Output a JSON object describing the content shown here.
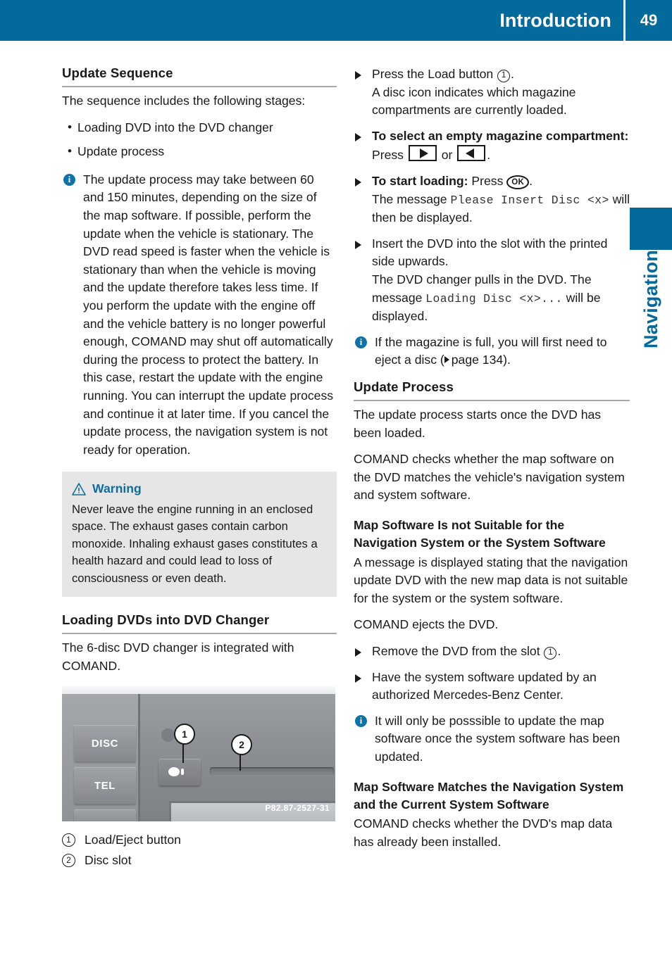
{
  "header": {
    "title": "Introduction",
    "page_number": "49"
  },
  "side_tab": {
    "label": "Navigation"
  },
  "left_column": {
    "section_heading": "Update Sequence",
    "intro": "The sequence includes the following stages:",
    "bullets": [
      "Loading DVD into the DVD changer",
      "Update process"
    ],
    "info_note": "The update process may take between 60 and 150 minutes, depending on the size of the map software. If possible, perform the update when the vehicle is stationary. The DVD read speed is faster when the vehicle is stationary than when the vehicle is moving and the update therefore takes less time. If you perform the update with the engine off and the vehicle battery is no longer powerful enough, COMAND may shut off automatically during the process to protect the battery. In this case, restart the update with the engine running. You can interrupt the update process and continue it at later time. If you cancel the update process, the navigation system is not ready for operation.",
    "warning": {
      "title": "Warning",
      "body": "Never leave the engine running in an enclosed space. The exhaust gases contain carbon monoxide. Inhaling exhaust gases constitutes a health hazard and could lead to loss of consciousness or even death."
    },
    "loading_heading": "Loading DVDs into DVD Changer",
    "loading_text": "The 6-disc DVD changer is integrated with COMAND.",
    "figure": {
      "button_disc": "DISC",
      "button_tel": "TEL",
      "callout_1": "1",
      "callout_2": "2",
      "image_code": "P82.87-2527-31"
    },
    "legend": [
      {
        "num": "1",
        "label": "Load/Eject button"
      },
      {
        "num": "2",
        "label": "Disc slot"
      }
    ]
  },
  "right_column": {
    "steps_top": [
      {
        "lead_plain": "Press the Load button ",
        "circnum": "1",
        "lead_tail": ".",
        "detail": "A disc icon indicates which magazine compartments are currently loaded."
      }
    ],
    "step_select": {
      "bold": "To select an empty magazine compartment:",
      "text_before": " Press ",
      "text_or": " or ",
      "text_end": "."
    },
    "step_start": {
      "bold": "To start loading:",
      "text_before": " Press ",
      "text_end": ".",
      "message_intro": "The message ",
      "message_mono": "Please Insert Disc <x>",
      "message_tail": " will then be displayed."
    },
    "step_insert": {
      "text": "Insert the DVD into the slot with the printed side upwards.",
      "detail_before": "The DVD changer pulls in the DVD. The message ",
      "detail_mono": "Loading Disc <x>...",
      "detail_tail": " will be displayed."
    },
    "info_note_magazine": {
      "text_before": "If the magazine is full, you will first need to eject a disc (",
      "pageref": "page 134",
      "text_after": ")."
    },
    "update_process_heading": "Update Process",
    "update_process_p1": "The update process starts once the DVD has been loaded.",
    "update_process_p2": "COMAND checks whether the map software on the DVD matches the vehicle's navigation system and system software.",
    "not_suitable_heading": "Map Software Is not Suitable for the Navigation System or the System Software",
    "not_suitable_p1": "A message is displayed stating that the navigation update DVD with the new map data is not suitable for the system or the system software.",
    "not_suitable_p2": "COMAND ejects the DVD.",
    "step_remove": {
      "text_before": "Remove the DVD from the slot ",
      "circnum": "1",
      "text_after": "."
    },
    "step_update_sw": "Have the system software updated by an authorized Mercedes-Benz Center.",
    "info_note_possible": "It will only be posssible to update the map software once the system software has been updated.",
    "matches_heading": "Map Software Matches the Navigation System and the Current System Software",
    "matches_p1": "COMAND checks whether the DVD's map data has already been installed."
  },
  "colors": {
    "brand_blue": "#04699b",
    "note_blue": "#1272a8",
    "warning_bg": "#e6e6e6"
  }
}
